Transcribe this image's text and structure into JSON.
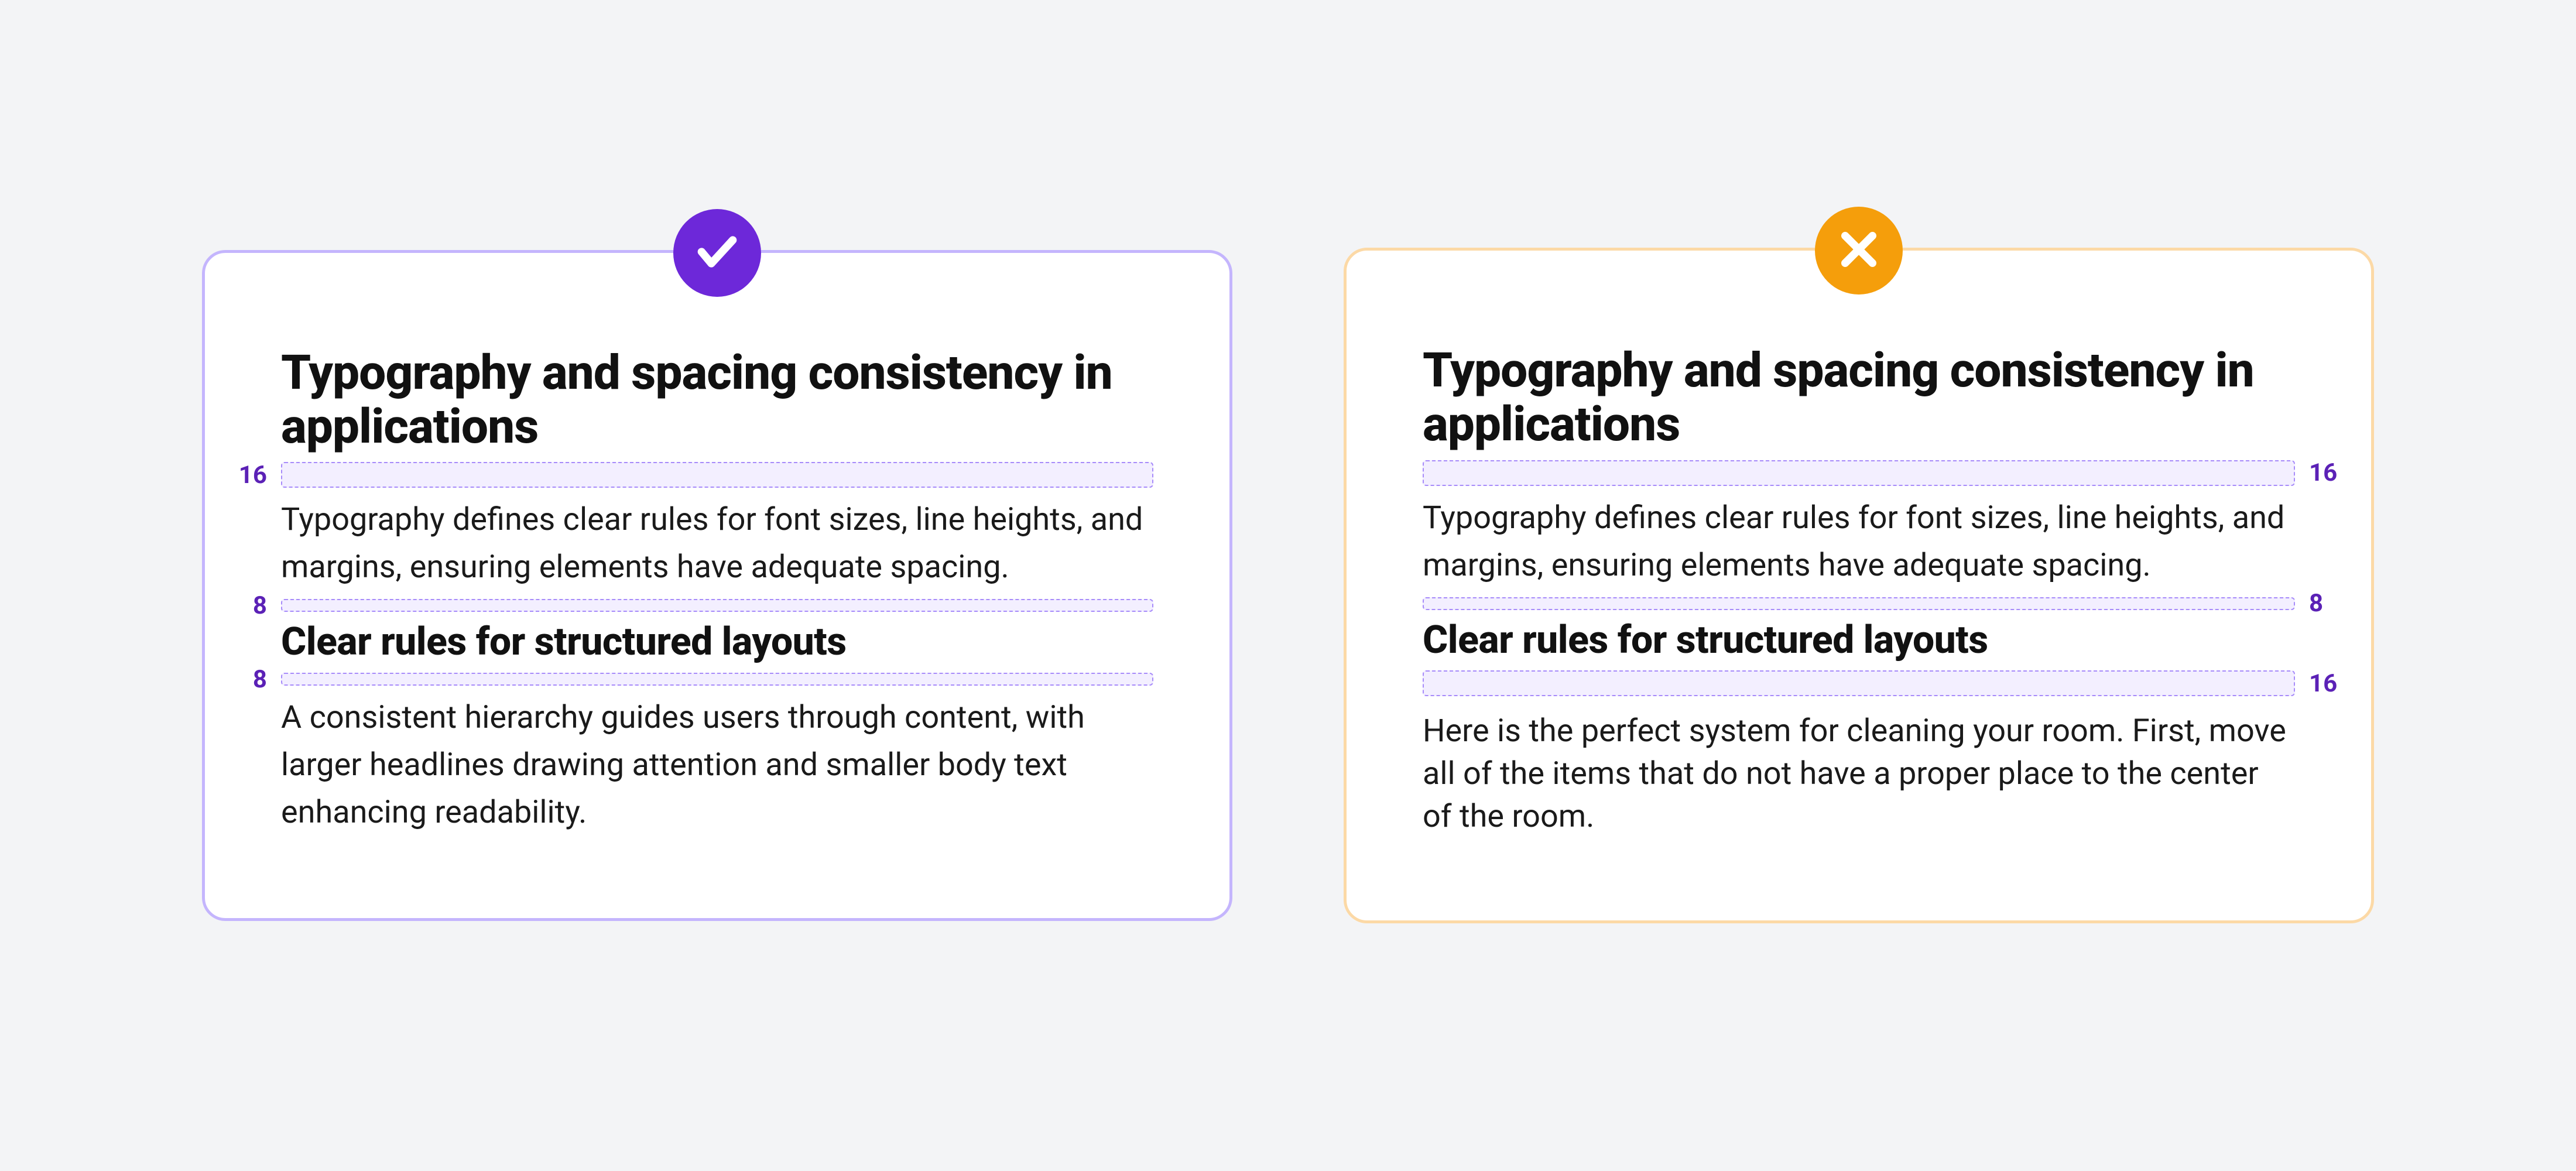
{
  "good": {
    "heading": "Typography and spacing consistency in applications",
    "gap1_label": "16",
    "body1": "Typography defines clear rules for font sizes, line heights, and margins, ensuring elements have adequate spacing.",
    "gap2_label": "8",
    "subheading": "Clear rules for structured layouts",
    "gap3_label": "8",
    "body2": " A consistent hierarchy guides users through content, with larger headlines drawing attention and smaller body text enhancing readability."
  },
  "bad": {
    "heading": "Typography and spacing consistency in applications",
    "gap1_label": "16",
    "body1": "Typography defines clear rules for font sizes, line heights, and margins, ensuring elements have adequate spacing.",
    "gap2_label": "8",
    "subheading": "Clear rules for structured layouts",
    "gap3_label": "16",
    "body2": "Here is the perfect system for cleaning your room. First, move all of the items that do not have a proper place to the center of the room."
  },
  "colors": {
    "good_border": "#c4b5fd",
    "bad_border": "#fcd9a6",
    "good_badge": "#6d28d9",
    "bad_badge": "#f59e0b",
    "gap_fill": "#f3efff",
    "gap_dash": "#a78bfa",
    "gap_text": "#5b21b6"
  },
  "icons": {
    "good": "check-icon",
    "bad": "x-icon"
  }
}
